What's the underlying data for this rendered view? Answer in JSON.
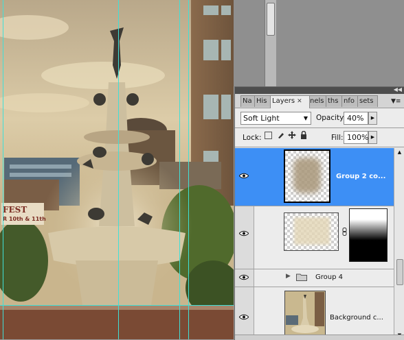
{
  "layers_panel": {
    "tabs": [
      "Na",
      "His",
      "Layers",
      "nels",
      "ths",
      "nfo",
      "sets"
    ],
    "active_tab": "Layers",
    "blend_mode": "Soft Light",
    "opacity_label": "Opacity:",
    "opacity_value": "40%",
    "lock_label": "Lock:",
    "fill_label": "Fill:",
    "fill_value": "100%",
    "layers": [
      {
        "name": "Group 2 co...",
        "selected": true,
        "visible": true
      },
      {
        "name": "",
        "selected": false,
        "visible": true,
        "has_mask": true
      },
      {
        "name": "Group 4",
        "selected": false,
        "visible": true,
        "is_group": true
      },
      {
        "name": "Background c...",
        "selected": false,
        "visible": true
      }
    ]
  },
  "canvas": {
    "banner_line1": "FEST",
    "banner_line2": "R 10th & 11th"
  }
}
